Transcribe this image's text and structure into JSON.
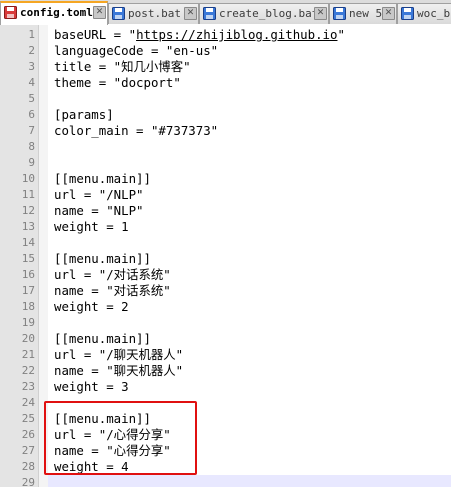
{
  "editor": {
    "tabs": [
      {
        "label": "config.toml",
        "active": true,
        "icon": "save-disk-icon-red"
      },
      {
        "label": "post.bat",
        "active": false,
        "icon": "save-disk-icon-blue"
      },
      {
        "label": "create_blog.bat",
        "active": false,
        "icon": "save-disk-icon-blue"
      },
      {
        "label": "new 5",
        "active": false,
        "icon": "save-disk-icon-blue"
      },
      {
        "label": "woc_b",
        "active": false,
        "icon": "save-disk-icon-blue"
      }
    ],
    "close_glyph": "✕",
    "colors": {
      "active_tab_accent": "#f5a623",
      "highlight_box": "#e01010",
      "current_line": "#e8e8ff",
      "line_number": "#808080"
    },
    "lines": [
      {
        "n": "1",
        "text": "baseURL = \"",
        "link": "https://zhijiblog.github.io",
        "after": "\""
      },
      {
        "n": "2",
        "text": "languageCode = \"en-us\""
      },
      {
        "n": "3",
        "text": "title = \"知几小博客\""
      },
      {
        "n": "4",
        "text": "theme = \"docport\""
      },
      {
        "n": "5",
        "text": ""
      },
      {
        "n": "6",
        "text": "[params]"
      },
      {
        "n": "7",
        "text": "color_main = \"#737373\""
      },
      {
        "n": "8",
        "text": ""
      },
      {
        "n": "9",
        "text": ""
      },
      {
        "n": "10",
        "text": "[[menu.main]]"
      },
      {
        "n": "11",
        "text": "url = \"/NLP\""
      },
      {
        "n": "12",
        "text": "name = \"NLP\""
      },
      {
        "n": "13",
        "text": "weight = 1"
      },
      {
        "n": "14",
        "text": ""
      },
      {
        "n": "15",
        "text": "[[menu.main]]"
      },
      {
        "n": "16",
        "text": "url = \"/对话系统\""
      },
      {
        "n": "17",
        "text": "name = \"对话系统\""
      },
      {
        "n": "18",
        "text": "weight = 2"
      },
      {
        "n": "19",
        "text": ""
      },
      {
        "n": "20",
        "text": "[[menu.main]]"
      },
      {
        "n": "21",
        "text": "url = \"/聊天机器人\""
      },
      {
        "n": "22",
        "text": "name = \"聊天机器人\""
      },
      {
        "n": "23",
        "text": "weight = 3"
      },
      {
        "n": "24",
        "text": ""
      },
      {
        "n": "25",
        "text": "[[menu.main]]"
      },
      {
        "n": "26",
        "text": "url = \"/心得分享\""
      },
      {
        "n": "27",
        "text": "name = \"心得分享\""
      },
      {
        "n": "28",
        "text": "weight = 4"
      },
      {
        "n": "29",
        "text": ""
      }
    ],
    "current_line": "29"
  }
}
